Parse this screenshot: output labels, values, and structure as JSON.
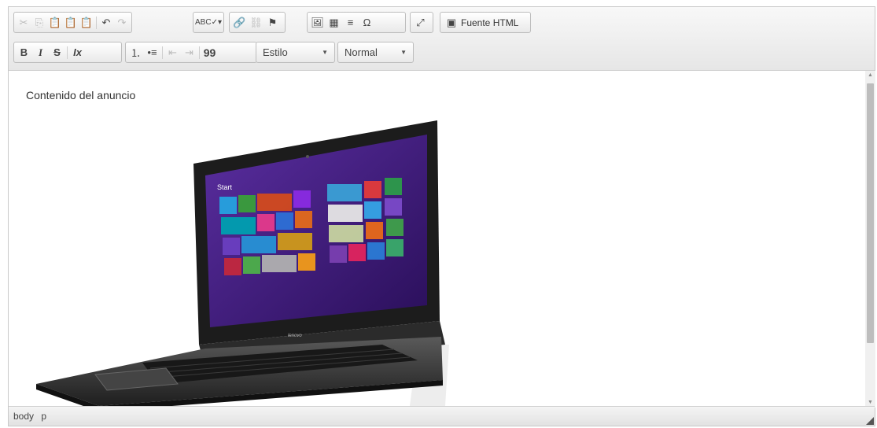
{
  "toolbar": {
    "source_label": "Fuente HTML",
    "style_combo": "Estilo",
    "format_combo": "Normal",
    "bold": "B",
    "italic": "I",
    "strike": "S",
    "quote": "99"
  },
  "content": {
    "text": "Contenido del anuncio",
    "screen_start": "Start",
    "laptop_brand": "lenovo"
  },
  "statusbar": {
    "path": [
      "body",
      "p"
    ]
  }
}
